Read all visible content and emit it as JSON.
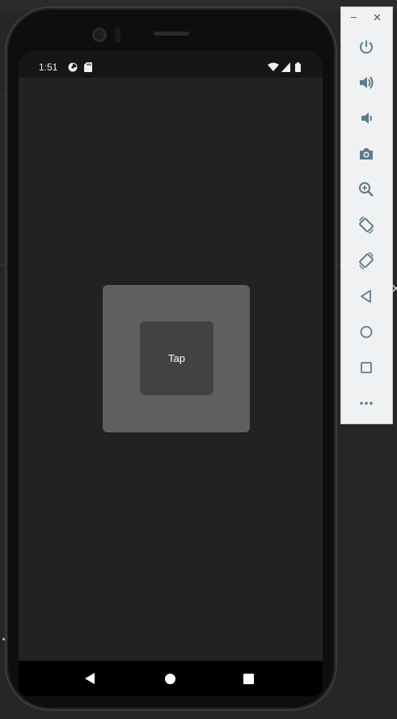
{
  "status_bar": {
    "time": "1:51",
    "left_icons": [
      "data-saver-icon",
      "sd-card-icon"
    ],
    "right_icons": [
      "wifi-icon",
      "signal-icon",
      "battery-icon"
    ]
  },
  "app": {
    "tap_label": "Tap",
    "colors": {
      "background": "#222222",
      "outer_box": "#5f5f5f",
      "inner_box": "#424242",
      "text": "#ffffff"
    }
  },
  "navigation_bar": {
    "buttons": [
      "back-icon",
      "home-icon",
      "recents-icon"
    ]
  },
  "emulator_toolbar": {
    "window_buttons": [
      "minimize-icon",
      "close-icon"
    ],
    "minimize_glyph": "–",
    "close_glyph": "✕",
    "buttons": [
      "power-icon",
      "volume-up-icon",
      "volume-down-icon",
      "camera-icon",
      "zoom-icon",
      "rotate-left-icon",
      "rotate-right-icon",
      "back-icon",
      "home-icon",
      "overview-icon",
      "more-icon"
    ],
    "icon_color": "#5f7c8a"
  }
}
